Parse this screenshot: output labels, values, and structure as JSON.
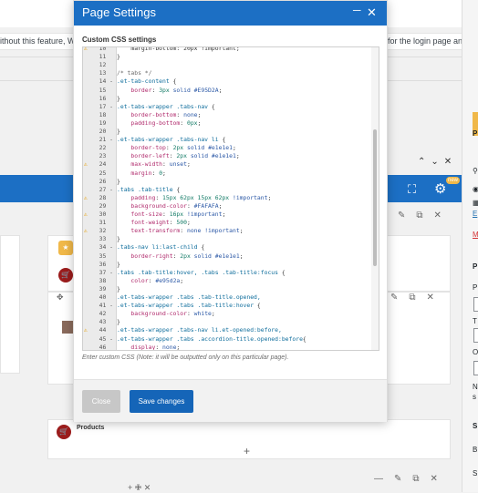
{
  "background": {
    "notice_left": "ithout this feature, WooC",
    "notice_right": "for the login page and user reg",
    "blue_bar_badge": "new",
    "products_label": "Products"
  },
  "modal": {
    "title": "Page Settings",
    "section_label": "Custom CSS settings",
    "hint": "Enter custom CSS (Note: it will be outputted only on this particular page).",
    "close_label": "Close",
    "save_label": "Save changes",
    "code_lines": [
      {
        "n": "10",
        "w": true,
        "f": "",
        "t": [
          [
            "    margin-bottom: 20px !important;",
            "c-txt"
          ]
        ]
      },
      {
        "n": "11",
        "w": false,
        "f": "",
        "t": [
          [
            "}",
            "c-txt"
          ]
        ]
      },
      {
        "n": "12",
        "w": false,
        "f": "",
        "t": [
          [
            "",
            "c-txt"
          ]
        ]
      },
      {
        "n": "13",
        "w": false,
        "f": "",
        "t": [
          [
            "/* tabs */",
            "c-com"
          ]
        ]
      },
      {
        "n": "14",
        "w": false,
        "f": "-",
        "t": [
          [
            ".et-tab-content ",
            "c-sel"
          ],
          [
            "{",
            "c-txt"
          ]
        ]
      },
      {
        "n": "15",
        "w": false,
        "f": "",
        "t": [
          [
            "    border",
            "c-prop"
          ],
          [
            ": ",
            "c-txt"
          ],
          [
            "3px",
            "c-num"
          ],
          [
            " solid ",
            "c-val"
          ],
          [
            "#E95D2A",
            "c-val"
          ],
          [
            ";",
            "c-txt"
          ]
        ]
      },
      {
        "n": "16",
        "w": false,
        "f": "",
        "t": [
          [
            "}",
            "c-txt"
          ]
        ]
      },
      {
        "n": "17",
        "w": false,
        "f": "-",
        "t": [
          [
            ".et-tabs-wrapper .tabs-nav ",
            "c-sel"
          ],
          [
            "{",
            "c-txt"
          ]
        ]
      },
      {
        "n": "18",
        "w": false,
        "f": "",
        "t": [
          [
            "    border-bottom",
            "c-prop"
          ],
          [
            ": ",
            "c-txt"
          ],
          [
            "none",
            "c-val"
          ],
          [
            ";",
            "c-txt"
          ]
        ]
      },
      {
        "n": "19",
        "w": false,
        "f": "",
        "t": [
          [
            "    padding-bottom",
            "c-prop"
          ],
          [
            ": ",
            "c-txt"
          ],
          [
            "0px",
            "c-num"
          ],
          [
            ";",
            "c-txt"
          ]
        ]
      },
      {
        "n": "20",
        "w": false,
        "f": "",
        "t": [
          [
            "}",
            "c-txt"
          ]
        ]
      },
      {
        "n": "21",
        "w": false,
        "f": "-",
        "t": [
          [
            ".et-tabs-wrapper .tabs-nav li ",
            "c-sel"
          ],
          [
            "{",
            "c-txt"
          ]
        ]
      },
      {
        "n": "22",
        "w": false,
        "f": "",
        "t": [
          [
            "    border-top",
            "c-prop"
          ],
          [
            ": ",
            "c-txt"
          ],
          [
            "2px",
            "c-num"
          ],
          [
            " solid ",
            "c-val"
          ],
          [
            "#e1e1e1",
            "c-val"
          ],
          [
            ";",
            "c-txt"
          ]
        ]
      },
      {
        "n": "23",
        "w": false,
        "f": "",
        "t": [
          [
            "    border-left",
            "c-prop"
          ],
          [
            ": ",
            "c-txt"
          ],
          [
            "2px",
            "c-num"
          ],
          [
            " solid ",
            "c-val"
          ],
          [
            "#e1e1e1",
            "c-val"
          ],
          [
            ";",
            "c-txt"
          ]
        ]
      },
      {
        "n": "24",
        "w": true,
        "f": "",
        "t": [
          [
            "    max-width",
            "c-prop"
          ],
          [
            ": ",
            "c-txt"
          ],
          [
            "unset",
            "c-val"
          ],
          [
            ";",
            "c-txt"
          ]
        ]
      },
      {
        "n": "25",
        "w": false,
        "f": "",
        "t": [
          [
            "    margin",
            "c-prop"
          ],
          [
            ": ",
            "c-txt"
          ],
          [
            "0",
            "c-num"
          ],
          [
            ";",
            "c-txt"
          ]
        ]
      },
      {
        "n": "26",
        "w": false,
        "f": "",
        "t": [
          [
            "}",
            "c-txt"
          ]
        ]
      },
      {
        "n": "27",
        "w": false,
        "f": "-",
        "t": [
          [
            ".tabs .tab-title ",
            "c-sel"
          ],
          [
            "{",
            "c-txt"
          ]
        ]
      },
      {
        "n": "28",
        "w": true,
        "f": "",
        "t": [
          [
            "    padding",
            "c-prop"
          ],
          [
            ": ",
            "c-txt"
          ],
          [
            "15px 62px 15px 62px",
            "c-num"
          ],
          [
            " !important",
            "c-val"
          ],
          [
            ";",
            "c-txt"
          ]
        ]
      },
      {
        "n": "29",
        "w": false,
        "f": "",
        "t": [
          [
            "    background-color",
            "c-prop"
          ],
          [
            ": ",
            "c-txt"
          ],
          [
            "#FAFAFA",
            "c-val"
          ],
          [
            ";",
            "c-txt"
          ]
        ]
      },
      {
        "n": "30",
        "w": true,
        "f": "",
        "t": [
          [
            "    font-size",
            "c-prop"
          ],
          [
            ": ",
            "c-txt"
          ],
          [
            "16px",
            "c-num"
          ],
          [
            " !important",
            "c-val"
          ],
          [
            ";",
            "c-txt"
          ]
        ]
      },
      {
        "n": "31",
        "w": false,
        "f": "",
        "t": [
          [
            "    font-weight",
            "c-prop"
          ],
          [
            ": ",
            "c-txt"
          ],
          [
            "500",
            "c-num"
          ],
          [
            ";",
            "c-txt"
          ]
        ]
      },
      {
        "n": "32",
        "w": true,
        "f": "",
        "t": [
          [
            "    text-transform",
            "c-prop"
          ],
          [
            ": ",
            "c-txt"
          ],
          [
            "none !important",
            "c-val"
          ],
          [
            ";",
            "c-txt"
          ]
        ]
      },
      {
        "n": "33",
        "w": false,
        "f": "",
        "t": [
          [
            "}",
            "c-txt"
          ]
        ]
      },
      {
        "n": "34",
        "w": false,
        "f": "-",
        "t": [
          [
            ".tabs-nav li:last-child ",
            "c-sel"
          ],
          [
            "{",
            "c-txt"
          ]
        ]
      },
      {
        "n": "35",
        "w": false,
        "f": "",
        "t": [
          [
            "    border-right",
            "c-prop"
          ],
          [
            ": ",
            "c-txt"
          ],
          [
            "2px",
            "c-num"
          ],
          [
            " solid ",
            "c-val"
          ],
          [
            "#e1e1e1",
            "c-val"
          ],
          [
            ";",
            "c-txt"
          ]
        ]
      },
      {
        "n": "36",
        "w": false,
        "f": "",
        "t": [
          [
            "}",
            "c-txt"
          ]
        ]
      },
      {
        "n": "37",
        "w": false,
        "f": "-",
        "t": [
          [
            ".tabs .tab-title:hover, .tabs .tab-title:focus ",
            "c-sel"
          ],
          [
            "{",
            "c-txt"
          ]
        ]
      },
      {
        "n": "38",
        "w": false,
        "f": "",
        "t": [
          [
            "    color",
            "c-prop"
          ],
          [
            ": ",
            "c-txt"
          ],
          [
            "#e95d2a",
            "c-val"
          ],
          [
            ";",
            "c-txt"
          ]
        ]
      },
      {
        "n": "39",
        "w": false,
        "f": "",
        "t": [
          [
            "}",
            "c-txt"
          ]
        ]
      },
      {
        "n": "40",
        "w": false,
        "f": "",
        "t": [
          [
            ".et-tabs-wrapper .tabs .tab-title.opened,",
            "c-sel"
          ]
        ]
      },
      {
        "n": "41",
        "w": false,
        "f": "-",
        "t": [
          [
            ".et-tabs-wrapper .tabs .tab-title:hover ",
            "c-sel"
          ],
          [
            "{",
            "c-txt"
          ]
        ]
      },
      {
        "n": "42",
        "w": false,
        "f": "",
        "t": [
          [
            "    background-color",
            "c-prop"
          ],
          [
            ": ",
            "c-txt"
          ],
          [
            "white",
            "c-val"
          ],
          [
            ";",
            "c-txt"
          ]
        ]
      },
      {
        "n": "43",
        "w": false,
        "f": "",
        "t": [
          [
            "}",
            "c-txt"
          ]
        ]
      },
      {
        "n": "44",
        "w": true,
        "f": "",
        "t": [
          [
            ".et-tabs-wrapper .tabs-nav li.et-opened:before,",
            "c-sel"
          ]
        ]
      },
      {
        "n": "45",
        "w": false,
        "f": "-",
        "t": [
          [
            ".et-tabs-wrapper .tabs .accordion-title.opened:before",
            "c-sel"
          ],
          [
            "{",
            "c-txt"
          ]
        ]
      },
      {
        "n": "46",
        "w": false,
        "f": "",
        "t": [
          [
            "    display",
            "c-prop"
          ],
          [
            ": ",
            "c-txt"
          ],
          [
            "none",
            "c-val"
          ],
          [
            ";",
            "c-txt"
          ]
        ]
      },
      {
        "n": "47",
        "w": false,
        "f": "",
        "t": [
          [
            "}",
            "c-txt"
          ]
        ]
      },
      {
        "n": "48",
        "w": false,
        "f": "",
        "t": [
          [
            "",
            "c-txt"
          ]
        ]
      }
    ]
  },
  "colors": {
    "header_blue": "#1c6fc4",
    "save_button": "#1565b8",
    "warning": "#e8a20c",
    "module_red": "#9b1c1c",
    "badge_yellow": "#f0b849"
  },
  "icons": [
    "minimize-icon",
    "close-icon",
    "warning-icon",
    "gear-icon",
    "fullscreen-icon",
    "cart-icon",
    "pencil-icon",
    "copy-icon",
    "delete-icon",
    "plus-icon",
    "move-icon",
    "chevron-up-icon",
    "chevron-down-icon"
  ]
}
